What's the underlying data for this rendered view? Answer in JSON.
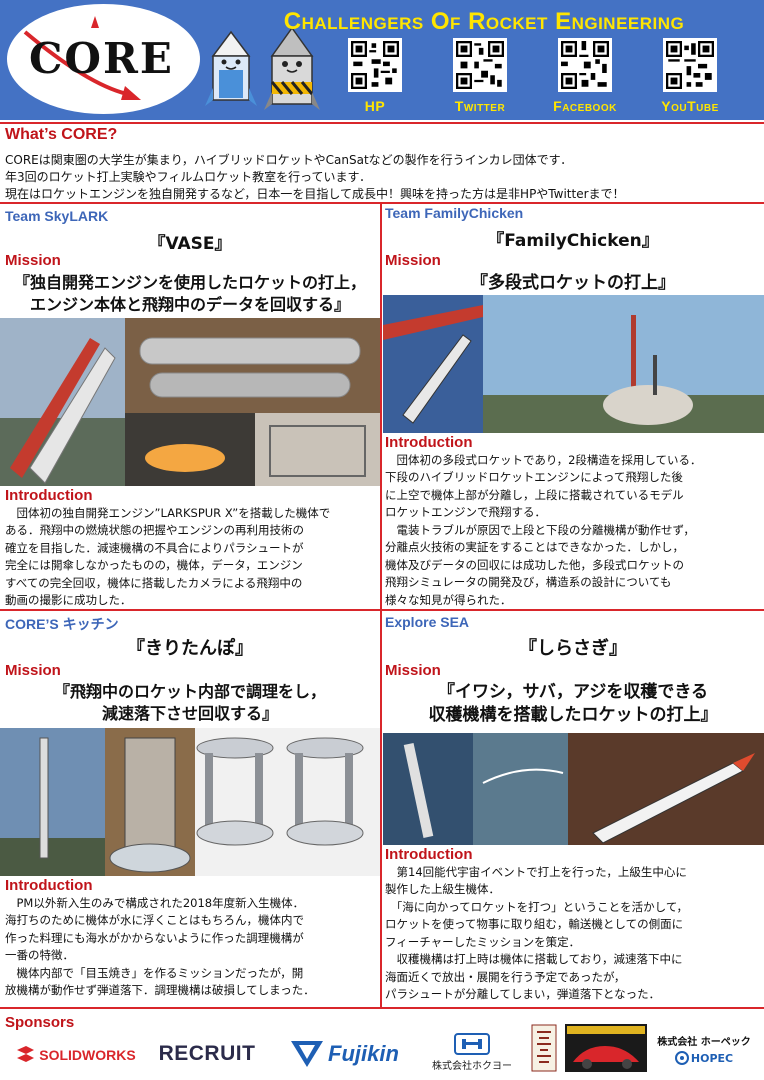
{
  "header": {
    "logo": "CORE",
    "title": "Challengers Of Rocket Engineering",
    "qr_codes": [
      {
        "label": "HP",
        "icon": "qr-code-icon"
      },
      {
        "label": "Twitter",
        "icon": "qr-code-icon"
      },
      {
        "label": "Facebook",
        "icon": "qr-code-icon"
      },
      {
        "label": "YouTube",
        "icon": "qr-code-icon"
      }
    ],
    "colors": {
      "bar": "#4472c4",
      "title": "#ffe500"
    }
  },
  "whats_core": {
    "title": "What’s CORE?",
    "lines": [
      "COREは関東圏の大学生が集まり，ハイブリッドロケットやCanSatなどの製作を行うインカレ団体です．",
      "年3回のロケット打上実験やフィルムロケット教室を行っています．",
      "現在はロケットエンジンを独自開発するなど，日本一を目指して成長中！興味を持った方は是非HPやTwitterまで！"
    ]
  },
  "labels": {
    "mission": "Mission",
    "introduction": "Introduction"
  },
  "teams": [
    {
      "team": "Team SkyLARK",
      "project": "『VASE』",
      "mission": [
        "『独自開発エンジンを使用したロケットの打上，",
        "エンジン本体と飛翔中のデータを回収する』"
      ],
      "intro": [
        "　団体初の独自開発エンジン”LARKSPUR X”を搭載した機体で",
        "ある．飛翔中の燃焼状態の把握やエンジンの再利用技術の",
        "確立を目指した．減速機構の不具合によりパラシュートが",
        "完全には開傘しなかったものの，機体，データ，エンジン",
        "すべての完全回収，機体に搭載したカメラによる飛翔中の",
        "動画の撮影に成功した．"
      ]
    },
    {
      "team": "Team FamilyChicken",
      "project": "『FamilyChicken』",
      "mission": [
        "『多段式ロケットの打上』"
      ],
      "intro": [
        "　団体初の多段式ロケットであり，2段構造を採用している．",
        "下段のハイブリッドロケットエンジンによって飛翔した後",
        "に上空で機体上部が分離し，上段に搭載されているモデル",
        "ロケットエンジンで飛翔する．",
        "　電装トラブルが原因で上段と下段の分離機構が動作せず，",
        "分離点火技術の実証をすることはできなかった．しかし，",
        "機体及びデータの回収には成功した他，多段式ロケットの",
        "飛翔シミュレータの開発及び，構造系の設計についても",
        "様々な知見が得られた．"
      ]
    },
    {
      "team": "CORE’S キッチン",
      "project": "『きりたんぽ』",
      "mission": [
        "『飛翔中のロケット内部で調理をし，",
        "減速落下させ回収する』"
      ],
      "intro": [
        "　PM以外新入生のみで構成された2018年度新入生機体．",
        "海打ちのために機体が水に浮くことはもちろん，機体内で",
        "作った料理にも海水がかからないように作った調理機構が",
        "一番の特徴．",
        "　機体内部で「目玉焼き」を作るミッションだったが，開",
        "放機構が動作せず弾道落下．調理機構は破損してしまった．"
      ]
    },
    {
      "team": "Explore SEA",
      "project": "『しらさぎ』",
      "mission": [
        "『イワシ，サバ，アジを収穫できる",
        "収穫機構を搭載したロケットの打上』"
      ],
      "intro": [
        "　第14回能代宇宙イベントで打上を行った，上級生中心に",
        "製作した上級生機体．",
        "　「海に向かってロケットを打つ」ということを活かして，",
        "ロケットを使って物事に取り組む，輸送機としての側面に",
        "フィーチャーしたミッションを策定．",
        "　収穫機構は打上時は機体に搭載しており，減速落下中に",
        "海面近くで放出・展開を行う予定であったが，",
        "パラシュートが分離してしまい，弾道落下となった．"
      ]
    }
  ],
  "sponsors": {
    "title": "Sponsors",
    "items": [
      "SOLIDWORKS",
      "RECRUIT",
      "Fujikin",
      "株式会社ホクヨー",
      "株式会社 ホーペック",
      "HOPEC"
    ]
  },
  "accent": "#d9262b",
  "team_color": "#3d66b8"
}
